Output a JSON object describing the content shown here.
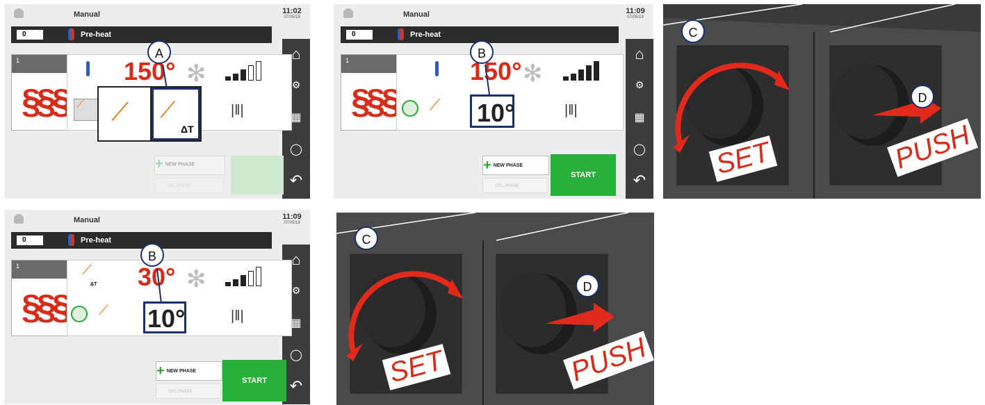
{
  "screens": [
    {
      "title": "Manual",
      "time": "11:02",
      "date": "07/05/19",
      "phase_num": "0",
      "phase_label": "Pre-heat",
      "phase_idx": "1",
      "temp": "150°",
      "callout": "A",
      "delta": "ΔT",
      "new_phase": "NEW PHASE",
      "del_phase": "DEL PHASE",
      "start": ""
    },
    {
      "title": "Manual",
      "time": "11:09",
      "date": "07/05/19",
      "phase_num": "0",
      "phase_label": "Pre-heat",
      "phase_idx": "1",
      "temp": "150°",
      "sub": "10°",
      "callout": "B",
      "new_phase": "NEW PHASE",
      "del_phase": "DEL PHASE",
      "start": "START"
    },
    {
      "title": "Manual",
      "time": "11:09",
      "date": "07/05/19",
      "phase_num": "0",
      "phase_label": "Pre-heat",
      "phase_idx": "1",
      "temp": "30°",
      "sub": "10°",
      "callout": "B",
      "delta": "ΔT",
      "new_phase": "NEW PHASE",
      "del_phase": "DEL PHASE",
      "start": "START"
    }
  ],
  "photos": [
    {
      "callout_knob": "C",
      "callout_push": "D",
      "set": "SET",
      "push": "PUSH"
    },
    {
      "callout_knob": "C",
      "callout_push": "D",
      "set": "SET",
      "push": "PUSH"
    }
  ],
  "colors": {
    "accent_red": "#d62c1a",
    "start_green": "#27b03a",
    "callout_navy": "#1a2f6e"
  }
}
